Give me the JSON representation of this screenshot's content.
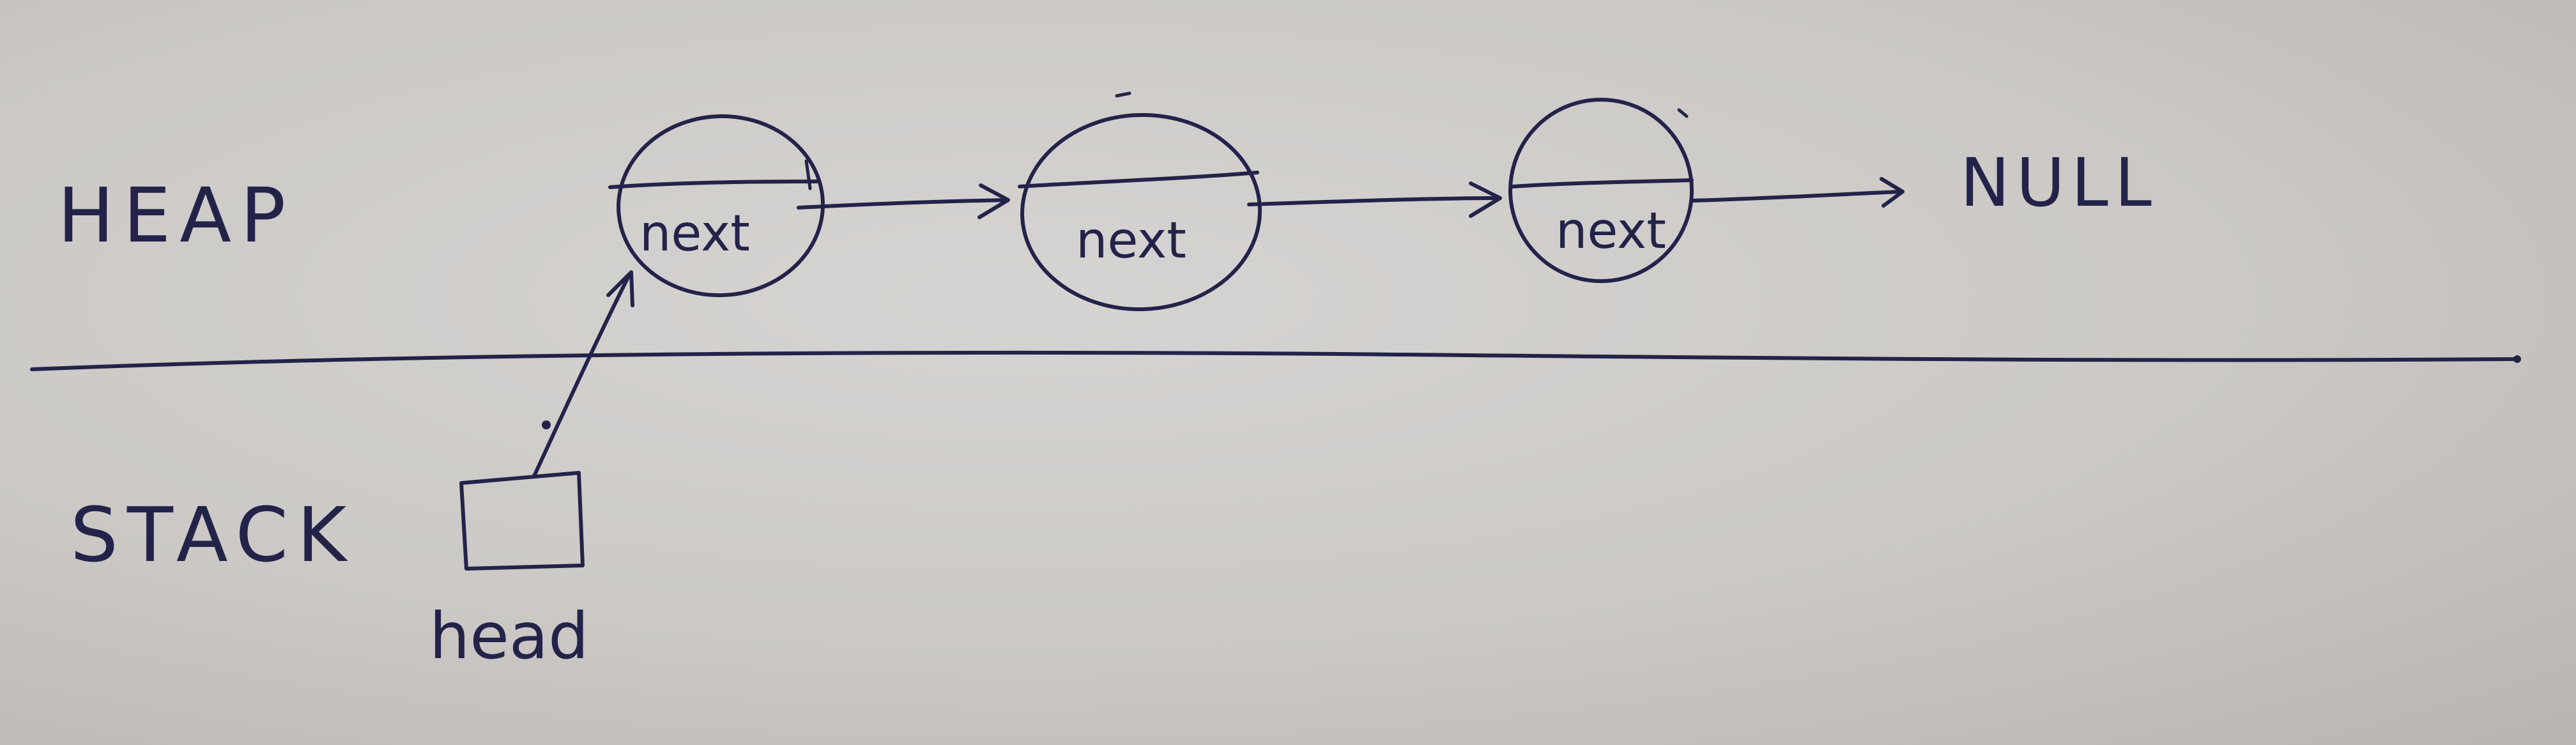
{
  "diagram": {
    "regions": {
      "heap_label": "HEAP",
      "stack_label": "STACK"
    },
    "nodes": [
      {
        "id": "node1",
        "field_label": "next"
      },
      {
        "id": "node2",
        "field_label": "next"
      },
      {
        "id": "node3",
        "field_label": "next"
      }
    ],
    "terminal_label": "NULL",
    "pointer_variable": {
      "label": "head"
    },
    "edges": [
      {
        "from": "head",
        "to": "node1"
      },
      {
        "from": "node1",
        "to": "node2"
      },
      {
        "from": "node2",
        "to": "node3"
      },
      {
        "from": "node3",
        "to": "NULL"
      }
    ],
    "colors": {
      "ink": "#23234a",
      "paper": "#cfccc9"
    }
  }
}
